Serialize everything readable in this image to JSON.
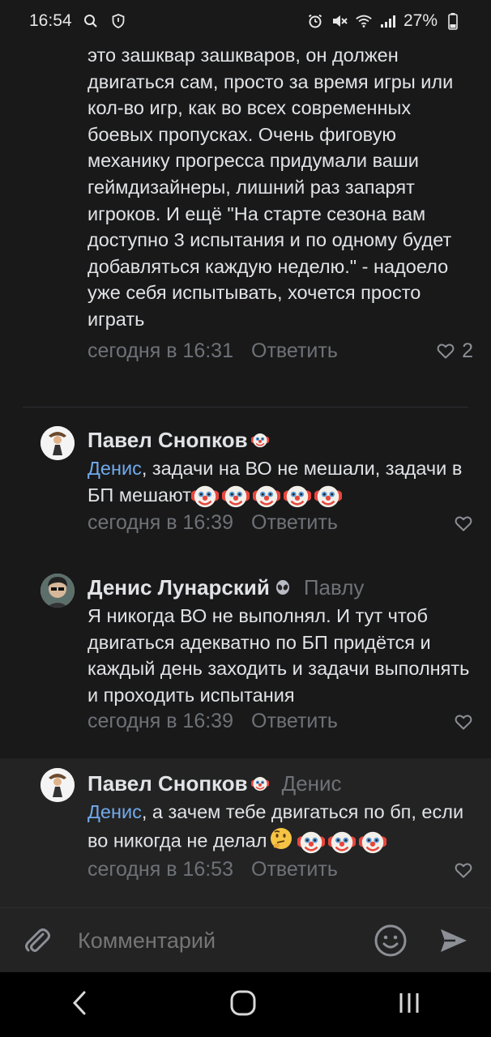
{
  "status_bar": {
    "time": "16:54",
    "battery": "27%"
  },
  "comments": [
    {
      "text": "это зашквар зашкваров, он должен двигаться сам, просто за время игры или кол-во игр, как во всех современных боевых пропусках. Очень фиговую механику прогресса придумали ваши геймдизайнеры, лишний раз запарят игроков. И ещё \"На старте сезона вам доступно 3 испытания и по одному будет добавляться каждую неделю.\" - надоело уже себя испытывать, хочется просто играть",
      "time": "сегодня в 16:31",
      "reply_label": "Ответить",
      "likes": "2"
    },
    {
      "author": "Павел Снопков",
      "mention": "Денис",
      "text": ", задачи на ВО не мешали, задачи в БП мешают",
      "time": "сегодня в 16:39",
      "reply_label": "Ответить"
    },
    {
      "author": "Денис Лунарский",
      "reply_to": "Павлу",
      "text": "Я никогда ВО не выполнял. И тут чтоб двигаться адекватно по БП придётся и каждый день заходить и задачи выполнять и проходить испытания",
      "time": "сегодня в 16:39",
      "reply_label": "Ответить"
    },
    {
      "author": "Павел Снопков",
      "reply_to": "Денис",
      "mention": "Денис",
      "text": ", а зачем тебе двигаться по бп, если во никогда не делал",
      "time": "сегодня в 16:53",
      "reply_label": "Ответить"
    }
  ],
  "input": {
    "placeholder": "Комментарий"
  },
  "colors": {
    "background": "#19191a",
    "mention": "#71aaeb",
    "muted": "#6e7277"
  },
  "icons": [
    "search-icon",
    "shield-icon",
    "alarm-icon",
    "mute-icon",
    "wifi-icon",
    "signal-icon",
    "battery-icon",
    "heart-icon",
    "clown-emoji",
    "thinking-emoji",
    "alien-emoji",
    "attach-icon",
    "smile-icon",
    "send-icon",
    "back-icon",
    "home-icon",
    "recents-icon"
  ]
}
